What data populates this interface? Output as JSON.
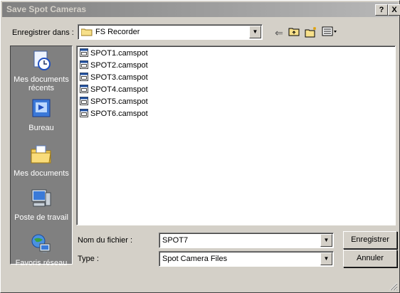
{
  "window": {
    "title": "Save Spot Cameras",
    "help_label": "?",
    "close_label": "X"
  },
  "save_in": {
    "label": "Enregistrer dans :",
    "value": "FS Recorder"
  },
  "places": [
    {
      "label": "Mes documents récents",
      "icon": "recent-documents-icon"
    },
    {
      "label": "Bureau",
      "icon": "desktop-icon"
    },
    {
      "label": "Mes documents",
      "icon": "my-documents-icon"
    },
    {
      "label": "Poste de travail",
      "icon": "my-computer-icon"
    },
    {
      "label": "Favoris réseau",
      "icon": "network-places-icon"
    }
  ],
  "files": [
    "SPOT1.camspot",
    "SPOT2.camspot",
    "SPOT3.camspot",
    "SPOT4.camspot",
    "SPOT5.camspot",
    "SPOT6.camspot"
  ],
  "filename": {
    "label": "Nom du fichier :",
    "value": "SPOT7"
  },
  "filetype": {
    "label": "Type :",
    "value": "Spot Camera Files"
  },
  "buttons": {
    "save": "Enregistrer",
    "cancel": "Annuler"
  }
}
